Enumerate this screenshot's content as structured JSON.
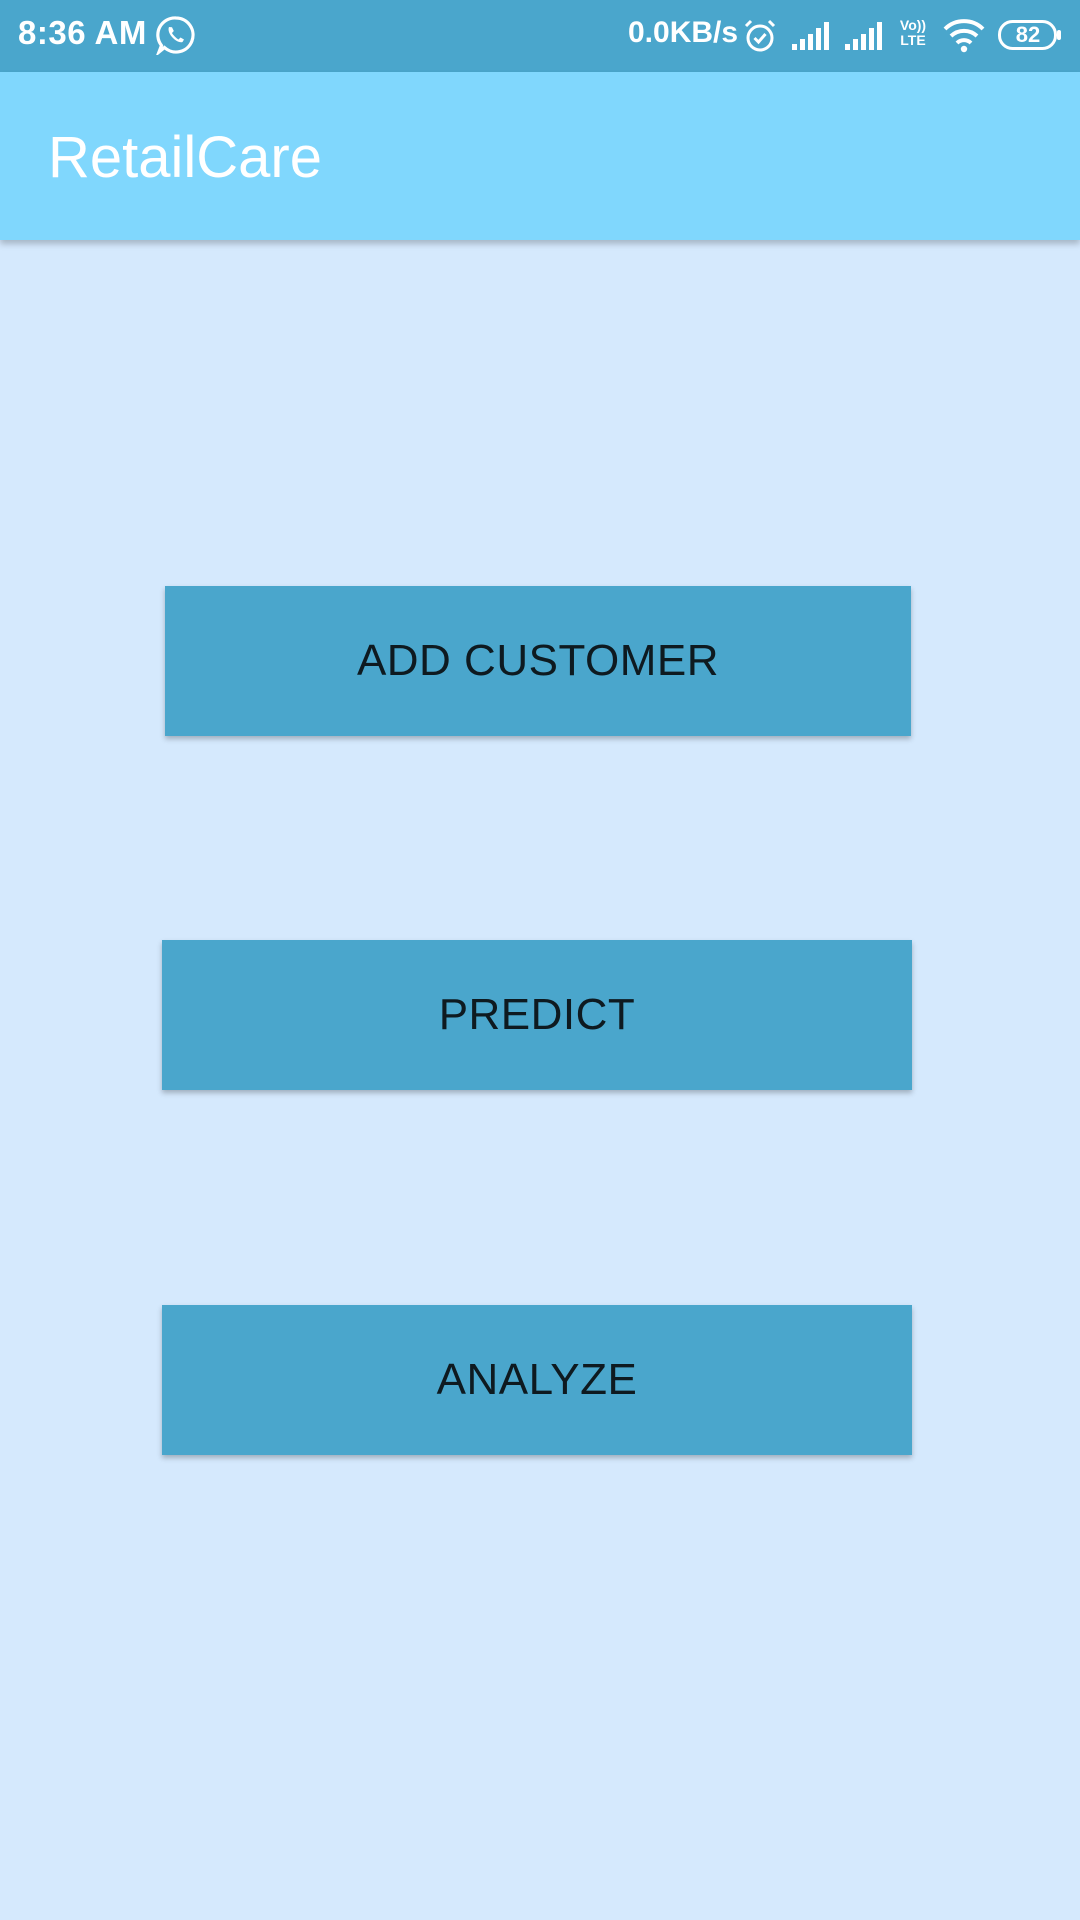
{
  "status_bar": {
    "time": "8:36 AM",
    "network_speed": "0.0KB/s",
    "battery_level": "82",
    "volte_label_top": "Vo))",
    "volte_label_bottom": "LTE",
    "icons": [
      "whatsapp-icon",
      "alarm-icon",
      "signal-icon",
      "signal-icon",
      "volte-icon",
      "wifi-icon",
      "battery-icon"
    ]
  },
  "app_bar": {
    "title": "RetailCare"
  },
  "main": {
    "buttons": [
      {
        "label": "ADD CUSTOMER"
      },
      {
        "label": "PREDICT"
      },
      {
        "label": "ANALYZE"
      }
    ]
  },
  "colors": {
    "status_bar": "#4aa6cc",
    "app_bar": "#80d7fd",
    "background": "#d5e9fd",
    "button": "#4aa6cc",
    "button_text": "#0e1a20"
  }
}
